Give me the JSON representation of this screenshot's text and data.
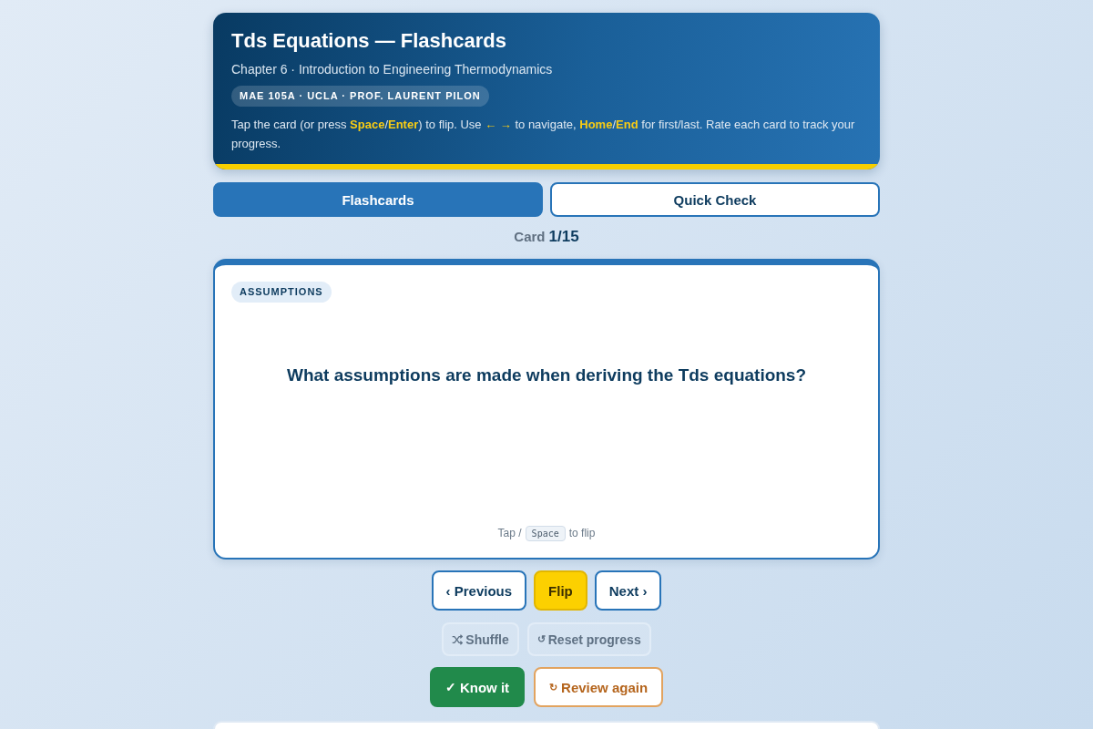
{
  "header": {
    "title": "Tds Equations — Flashcards",
    "subtitle": "Chapter 6 · Introduction to Engineering Thermodynamics",
    "badge": "MAE 105A · UCLA · PROF. LAURENT PILON",
    "instructions": [
      {
        "kind": "plain",
        "text": "Tap the card (or press "
      },
      {
        "kind": "key",
        "text": "Space"
      },
      {
        "kind": "plain",
        "text": "/"
      },
      {
        "kind": "key",
        "text": "Enter"
      },
      {
        "kind": "plain",
        "text": ") to flip. Use "
      },
      {
        "kind": "arrow",
        "text": "← →"
      },
      {
        "kind": "plain",
        "text": " to navigate, "
      },
      {
        "kind": "key",
        "text": "Home"
      },
      {
        "kind": "plain",
        "text": "/"
      },
      {
        "kind": "key",
        "text": "End"
      },
      {
        "kind": "plain",
        "text": " for first/last. Rate each card to track your progress."
      }
    ]
  },
  "tabs": [
    {
      "label": "Flashcards",
      "selected": true
    },
    {
      "label": "Quick Check",
      "selected": false
    }
  ],
  "counter": {
    "label": "Card",
    "value": "1/15"
  },
  "card": {
    "tag": "ASSUMPTIONS",
    "question": "What assumptions are made when deriving the Tds equations?",
    "hint": {
      "before": "Tap /",
      "key": "Space",
      "after": "to flip"
    }
  },
  "navigation": [
    {
      "kind": "outline",
      "label": "‹ Previous"
    },
    {
      "kind": "primary",
      "label": "Flip"
    },
    {
      "kind": "outline",
      "label": "Next ›"
    }
  ],
  "tools": [
    {
      "kind": "shuffle",
      "label": "Shuffle"
    },
    {
      "kind": "reset",
      "symbol": "↺",
      "label": "Reset progress"
    }
  ],
  "rating": [
    {
      "kind": "known",
      "symbol": "✓",
      "label": "Know it"
    },
    {
      "kind": "review",
      "symbol": "↻",
      "label": "Review again"
    }
  ]
}
